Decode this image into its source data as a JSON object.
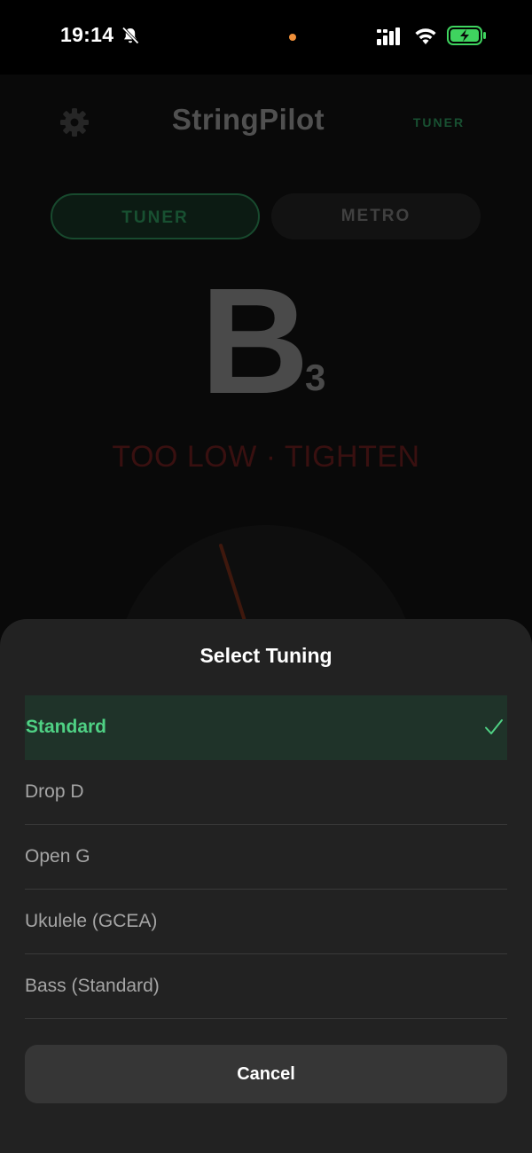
{
  "status_bar": {
    "time": "19:14",
    "icons": [
      "bell-muted-icon",
      "signal-icon",
      "wifi-icon",
      "battery-charging-icon"
    ]
  },
  "app": {
    "title": "StringPilot",
    "mode_label": "TUNER",
    "tabs": [
      {
        "label": "TUNER",
        "active": true
      },
      {
        "label": "METRO",
        "active": false
      }
    ],
    "note": {
      "letter": "B",
      "octave": "3"
    },
    "status_text": "TOO LOW · TIGHTEN",
    "colors": {
      "accent": "#2f9a5f",
      "status": "#6e1f1f",
      "needle": "#7a2f1a"
    }
  },
  "sheet": {
    "title": "Select Tuning",
    "options": [
      {
        "label": "Standard",
        "selected": true
      },
      {
        "label": "Drop D",
        "selected": false
      },
      {
        "label": "Open G",
        "selected": false
      },
      {
        "label": "Ukulele (GCEA)",
        "selected": false
      },
      {
        "label": "Bass (Standard)",
        "selected": false
      }
    ],
    "cancel_label": "Cancel",
    "colors": {
      "selected_text": "#4fd184",
      "selected_bg": "#1f3329"
    }
  }
}
